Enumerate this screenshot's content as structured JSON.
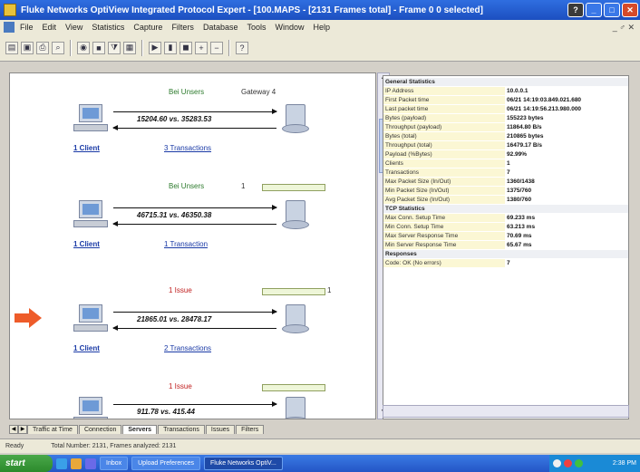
{
  "window": {
    "title": "Fluke Networks OptiView Integrated Protocol Expert - [100.MAPS - [2131 Frames total] - Frame 0 0 selected]",
    "buttons": {
      "help": "?",
      "minimize": "_",
      "maximize": "□",
      "close": "✕"
    }
  },
  "menu": {
    "items": [
      "File",
      "Edit",
      "View",
      "Statistics",
      "Capture",
      "Filters",
      "Database",
      "Tools",
      "Window",
      "Help"
    ],
    "mdi": "_ ♂ ✕"
  },
  "toolbar": {
    "buttons": [
      "open",
      "save",
      "print",
      "find",
      "capture",
      "stop",
      "filter",
      "chart",
      "play",
      "pause",
      "stop-rec",
      "zoom-in",
      "zoom-out",
      "help"
    ]
  },
  "diagram": {
    "blocks": [
      {
        "label": "Bei Unsers",
        "label_color": "green",
        "server": "Gateway 4",
        "rate": "15204.60 vs. 35283.53",
        "client": "1 Client",
        "transactions": "3 Transactions"
      },
      {
        "label": "Bei Unsers",
        "label_color": "green",
        "server": "1",
        "rate": "46715.31 vs. 46350.38",
        "client": "1 Client",
        "transactions": "1 Transaction"
      },
      {
        "label": "1 Issue",
        "label_color": "red",
        "server": "1",
        "rate": "21865.01 vs. 28478.17",
        "client": "1 Client",
        "transactions": "2 Transactions"
      },
      {
        "label": "1 Issue",
        "label_color": "red",
        "server": "",
        "rate": "911.78 vs. 415.44",
        "client": "",
        "transactions": ""
      }
    ]
  },
  "stats": {
    "rows": [
      {
        "k": "General Statistics",
        "v": "",
        "type": "header"
      },
      {
        "k": "IP Address",
        "v": "10.0.0.1"
      },
      {
        "k": "First Packet time",
        "v": "06/21 14:19:03.849.021.680"
      },
      {
        "k": "Last packet time",
        "v": "06/21 14:19:56.213.980.000"
      },
      {
        "k": "Bytes (payload)",
        "v": "155223 bytes"
      },
      {
        "k": "Throughput (payload)",
        "v": "11864.80 B/s"
      },
      {
        "k": "Bytes (total)",
        "v": "210865 bytes"
      },
      {
        "k": "Throughput (total)",
        "v": "16479.17 B/s"
      },
      {
        "k": "Payload (%Bytes)",
        "v": "92.99%"
      },
      {
        "k": "Clients",
        "v": "1"
      },
      {
        "k": "Transactions",
        "v": "7"
      },
      {
        "k": "Max Packet Size (In/Out)",
        "v": "1360/1438"
      },
      {
        "k": "Min Packet Size (In/Out)",
        "v": "1375/760"
      },
      {
        "k": "Avg Packet Size (In/Out)",
        "v": "1380/760"
      },
      {
        "k": "TCP Statistics",
        "v": "",
        "type": "section"
      },
      {
        "k": "Max Conn. Setup Time",
        "v": "69.233 ms"
      },
      {
        "k": "Min Conn. Setup Time",
        "v": "63.213 ms"
      },
      {
        "k": "Max Server Response Time",
        "v": "70.69 ms"
      },
      {
        "k": "Min Server Response Time",
        "v": "65.67 ms"
      },
      {
        "k": "Responses",
        "v": "",
        "type": "section"
      },
      {
        "k": "Code: OK (No errors)",
        "v": "7"
      }
    ]
  },
  "tabs": [
    "Traffic at Time",
    "Connection",
    "Servers",
    "Transactions",
    "Issues",
    "Filters"
  ],
  "status": {
    "left": "Ready",
    "message": "Total Number: 2131, Frames analyzed: 2131"
  },
  "taskbar": {
    "start": "start",
    "items": [
      "Inbox",
      "Upload Preferences",
      "Fluke Networks OptiV..."
    ],
    "clock": "2:38 PM"
  },
  "colors": {
    "title": "#1c4fc0",
    "issue": "#c02020",
    "ok": "#2c7a2c",
    "arrow": "#ee5c2a"
  }
}
